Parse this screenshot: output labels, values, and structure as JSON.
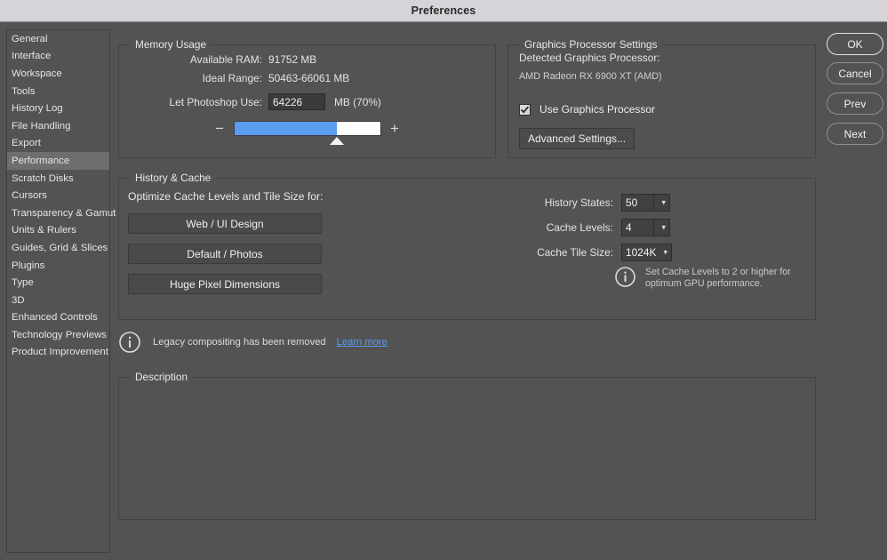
{
  "window": {
    "title": "Preferences"
  },
  "sidebar": {
    "items": [
      {
        "label": "General",
        "selected": false
      },
      {
        "label": "Interface",
        "selected": false
      },
      {
        "label": "Workspace",
        "selected": false
      },
      {
        "label": "Tools",
        "selected": false
      },
      {
        "label": "History Log",
        "selected": false
      },
      {
        "label": "File Handling",
        "selected": false
      },
      {
        "label": "Export",
        "selected": false
      },
      {
        "label": "Performance",
        "selected": true
      },
      {
        "label": "Scratch Disks",
        "selected": false
      },
      {
        "label": "Cursors",
        "selected": false
      },
      {
        "label": "Transparency & Gamut",
        "selected": false
      },
      {
        "label": "Units & Rulers",
        "selected": false
      },
      {
        "label": "Guides, Grid & Slices",
        "selected": false
      },
      {
        "label": "Plugins",
        "selected": false
      },
      {
        "label": "Type",
        "selected": false
      },
      {
        "label": "3D",
        "selected": false
      },
      {
        "label": "Enhanced Controls",
        "selected": false
      },
      {
        "label": "Technology Previews",
        "selected": false
      },
      {
        "label": "Product Improvement",
        "selected": false
      }
    ]
  },
  "memory_usage": {
    "legend": "Memory Usage",
    "available_ram_label": "Available RAM:",
    "available_ram_value": "91752 MB",
    "ideal_range_label": "Ideal Range:",
    "ideal_range_value": "50463-66061 MB",
    "let_photoshop_use_label": "Let Photoshop Use:",
    "let_photoshop_use_value": "64226",
    "let_photoshop_use_suffix": "MB (70%)",
    "slider_percent": 70,
    "slider_minus": "−",
    "slider_plus": "+",
    "fill_color": "#5b9bf0"
  },
  "graphics_processor": {
    "legend": "Graphics Processor Settings",
    "detected_label": "Detected Graphics Processor:",
    "detected_value": "AMD Radeon RX 6900 XT (AMD)",
    "use_gpu_label": "Use Graphics Processor",
    "use_gpu_checked": true,
    "advanced_settings_label": "Advanced Settings..."
  },
  "history_cache": {
    "legend": "History & Cache",
    "optimize_label": "Optimize Cache Levels and Tile Size for:",
    "preset_buttons": [
      "Web / UI Design",
      "Default / Photos",
      "Huge Pixel Dimensions"
    ],
    "selects": [
      {
        "label": "History States:",
        "value": "50",
        "width": "narrow"
      },
      {
        "label": "Cache Levels:",
        "value": "4",
        "width": "narrow"
      },
      {
        "label": "Cache Tile Size:",
        "value": "1024K",
        "width": "wide"
      }
    ],
    "note_line1": "Set Cache Levels to 2 or higher for",
    "note_line2": "optimum GPU performance."
  },
  "legacy_notice": {
    "text": "Legacy compositing has been removed",
    "link_label": "Learn more",
    "link_color": "#5b9bf0"
  },
  "description": {
    "legend": "Description",
    "body": ""
  },
  "actions": {
    "buttons": [
      {
        "label": "OK",
        "primary": true
      },
      {
        "label": "Cancel",
        "primary": false
      },
      {
        "label": "Prev",
        "primary": false
      },
      {
        "label": "Next",
        "primary": false
      }
    ]
  }
}
